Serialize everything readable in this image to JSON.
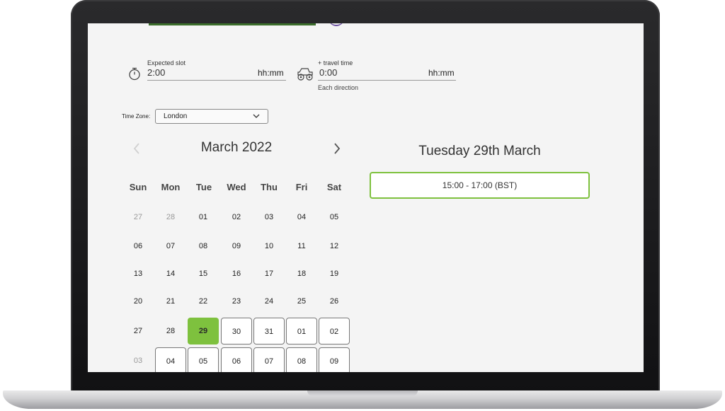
{
  "slot": {
    "label": "Expected slot",
    "value": "2:00",
    "unit": "hh:mm"
  },
  "travel": {
    "label": "+ travel time",
    "value": "0:00",
    "unit": "hh:mm",
    "note": "Each direction"
  },
  "timezone": {
    "label": "Time Zone:",
    "selected": "London"
  },
  "calendar": {
    "title": "March 2022",
    "weekdays": [
      "Sun",
      "Mon",
      "Tue",
      "Wed",
      "Thu",
      "Fri",
      "Sat"
    ],
    "weeks": [
      [
        "27",
        "28",
        "01",
        "02",
        "03",
        "04",
        "05"
      ],
      [
        "06",
        "07",
        "08",
        "09",
        "10",
        "11",
        "12"
      ],
      [
        "13",
        "14",
        "15",
        "16",
        "17",
        "18",
        "19"
      ],
      [
        "20",
        "21",
        "22",
        "23",
        "24",
        "25",
        "26"
      ],
      [
        "27",
        "28",
        "29",
        "30",
        "31",
        "01",
        "02"
      ],
      [
        "03",
        "04",
        "05",
        "06",
        "07",
        "08",
        "09"
      ]
    ],
    "selected_day": "29"
  },
  "selection": {
    "heading": "Tuesday 29th March",
    "slot_label": "15:00 - 17:00 (BST)"
  },
  "colors": {
    "accent": "#7ec13e",
    "dark_green": "#3c6e2b",
    "text": "#333333"
  },
  "icons": {
    "slot": "stopwatch-icon",
    "travel": "monster-truck-icon",
    "prev": "chevron-left-icon",
    "next": "chevron-right-icon",
    "select": "chevron-down-icon"
  }
}
